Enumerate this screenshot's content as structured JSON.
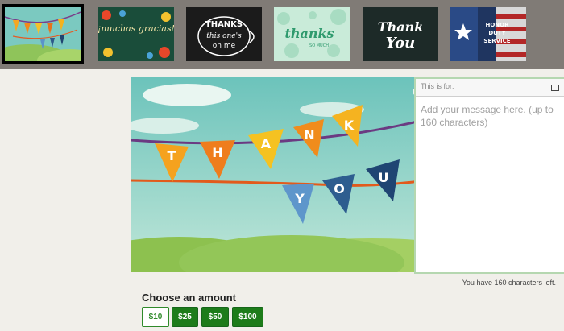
{
  "thumbnails": [
    {
      "label": "THANK YOU"
    },
    {
      "label": "¡muchas gracias!"
    },
    {
      "label": "THANKS this one's on me"
    },
    {
      "label": "thanks so much"
    },
    {
      "label": "Thank You"
    },
    {
      "label": "HONOR DUTY SERVICE"
    }
  ],
  "card": {
    "banner_letters_top": [
      "T",
      "H",
      "A",
      "N",
      "K"
    ],
    "banner_letters_bottom": [
      "Y",
      "O",
      "U"
    ]
  },
  "recipient": {
    "placeholder": "This is for:"
  },
  "message": {
    "placeholder": "Add your message here. (up to 160 characters)"
  },
  "char_count": "You have 160 characters left.",
  "amounts": {
    "title": "Choose an amount",
    "options": [
      "$10",
      "$25",
      "$50",
      "$100"
    ],
    "selected": "$10"
  }
}
